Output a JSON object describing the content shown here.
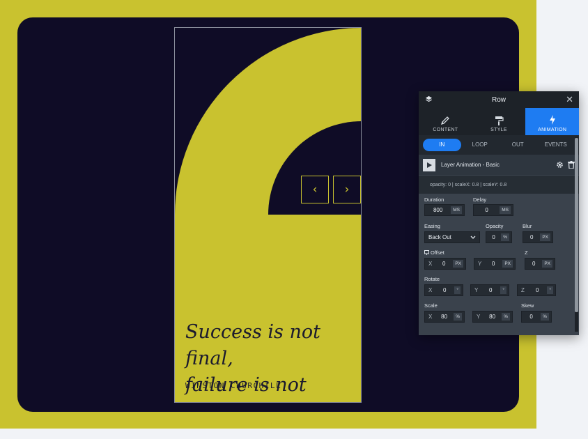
{
  "slide": {
    "quote_line1": "Success is not final,",
    "quote_line2": "failure is not fatal.",
    "author": "WINSTON CHURCHILL",
    "prev_glyph": "‹",
    "next_glyph": "›",
    "colors": {
      "yellow": "#c9c22f",
      "navy": "#0f0c26"
    }
  },
  "panel": {
    "title": "Row",
    "close_glyph": "✕",
    "tabs": [
      {
        "label": "CONTENT",
        "icon": "pencil-icon"
      },
      {
        "label": "STYLE",
        "icon": "paint-roller-icon"
      },
      {
        "label": "ANIMATION",
        "icon": "lightning-icon",
        "active": true
      }
    ],
    "subtabs": [
      "IN",
      "LOOP",
      "OUT",
      "EVENTS"
    ],
    "active_subtab": "IN",
    "layer_label": "Layer Animation - Basic",
    "summary": "opacity: 0 | scaleX: 0.8 | scaleY: 0.8",
    "fields": {
      "duration_label": "Duration",
      "duration_value": "800",
      "duration_unit": "MS",
      "delay_label": "Delay",
      "delay_value": "0",
      "delay_unit": "MS",
      "easing_label": "Easing",
      "easing_value": "Back Out",
      "opacity_label": "Opacity",
      "opacity_value": "0",
      "opacity_unit": "%",
      "blur_label": "Blur",
      "blur_value": "0",
      "blur_unit": "PX",
      "offset_label": "Offset",
      "z_label": "Z",
      "offset_x": "0",
      "offset_y": "0",
      "offset_z": "0",
      "offset_unit": "PX",
      "rotate_label": "Rotate",
      "rotate_x": "0",
      "rotate_y": "0",
      "rotate_z": "0",
      "rotate_unit": "°",
      "scale_label": "Scale",
      "scale_x": "80",
      "scale_y": "80",
      "scale_unit": "%",
      "skew_label": "Skew",
      "skew_value": "0",
      "skew_unit": "%",
      "x": "X",
      "y": "Y",
      "z": "Z"
    },
    "accent": "#1e7cf2"
  }
}
